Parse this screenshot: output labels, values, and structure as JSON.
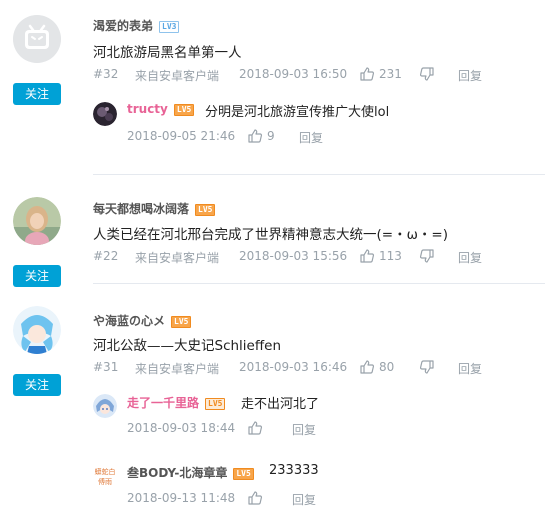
{
  "follow_label": "关注",
  "reply_label": "回复",
  "comments": [
    {
      "username": "渴爱的表弟",
      "level": "LV3",
      "text": "河北旅游局黑名单第一人",
      "floor": "#32",
      "source": "来自安卓客户端",
      "time": "2018-09-03 16:50",
      "likes": "231",
      "replies": [
        {
          "username": "tructy",
          "level": "LV5",
          "text": "分明是河北旅游宣传推广大使lol",
          "time": "2018-09-05 21:46",
          "likes": "9"
        }
      ]
    },
    {
      "username": "每天都想喝冰阔落",
      "level": "LV5",
      "text": "人类已经在河北邢台完成了世界精神意志大统一(=・ω・=)",
      "floor": "#22",
      "source": "来自安卓客户端",
      "time": "2018-09-03 15:56",
      "likes": "113",
      "replies": []
    },
    {
      "username": "や海蓝の心メ",
      "level": "LV5",
      "text": "河北公敌——大史记Schlieffen",
      "floor": "#31",
      "source": "来自安卓客户端",
      "time": "2018-09-03 16:46",
      "likes": "80",
      "replies": [
        {
          "username": "走了一千里路",
          "level": "LV5",
          "text": "走不出河北了",
          "time": "2018-09-03 18:44",
          "likes": ""
        },
        {
          "username": "叁BODY-北海章章",
          "level": "LV5",
          "text": "233333",
          "time": "2018-09-13 11:48",
          "likes": ""
        }
      ]
    }
  ]
}
